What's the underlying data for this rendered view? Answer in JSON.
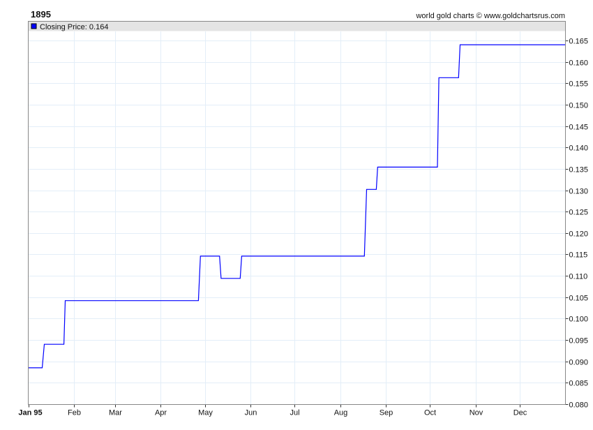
{
  "chart_data": {
    "type": "line",
    "title": "1895",
    "credit": "world gold charts © www.goldchartsrus.com",
    "legend": {
      "label": "Closing Price: 0.164",
      "color": "#0000ff",
      "placement": "top-left"
    },
    "xlabel": "",
    "ylabel": "",
    "x_unit": "day of year 1895",
    "xlim": [
      0,
      365
    ],
    "ylim": [
      0.08,
      0.167
    ],
    "y_ticks": [
      "0.080",
      "0.085",
      "0.090",
      "0.095",
      "0.100",
      "0.105",
      "0.110",
      "0.115",
      "0.120",
      "0.125",
      "0.130",
      "0.135",
      "0.140",
      "0.145",
      "0.150",
      "0.155",
      "0.160",
      "0.165"
    ],
    "x_ticks": [
      {
        "label": "Jan 95",
        "day": 0
      },
      {
        "label": "Feb",
        "day": 31
      },
      {
        "label": "Mar",
        "day": 59
      },
      {
        "label": "Apr",
        "day": 90
      },
      {
        "label": "May",
        "day": 120
      },
      {
        "label": "Jun",
        "day": 151
      },
      {
        "label": "Jul",
        "day": 181
      },
      {
        "label": "Aug",
        "day": 212
      },
      {
        "label": "Sep",
        "day": 243
      },
      {
        "label": "Oct",
        "day": 273
      },
      {
        "label": "Nov",
        "day": 304
      },
      {
        "label": "Dec",
        "day": 334
      }
    ],
    "grid": true,
    "series": [
      {
        "name": "Closing Price",
        "color": "#0000ff",
        "points": [
          [
            0,
            0.0885
          ],
          [
            9.5,
            0.0885
          ],
          [
            10.9,
            0.094
          ],
          [
            24.2,
            0.094
          ],
          [
            25.1,
            0.1042
          ],
          [
            115.6,
            0.1042
          ],
          [
            117,
            0.1146
          ],
          [
            130,
            0.1146
          ],
          [
            131,
            0.1094
          ],
          [
            144,
            0.1094
          ],
          [
            145,
            0.1146
          ],
          [
            228.4,
            0.1146
          ],
          [
            229.9,
            0.1302
          ],
          [
            236.5,
            0.1302
          ],
          [
            237.4,
            0.1354
          ],
          [
            278,
            0.1354
          ],
          [
            279,
            0.1563
          ],
          [
            292.4,
            0.1563
          ],
          [
            293.4,
            0.164
          ],
          [
            365,
            0.164
          ]
        ]
      }
    ]
  }
}
